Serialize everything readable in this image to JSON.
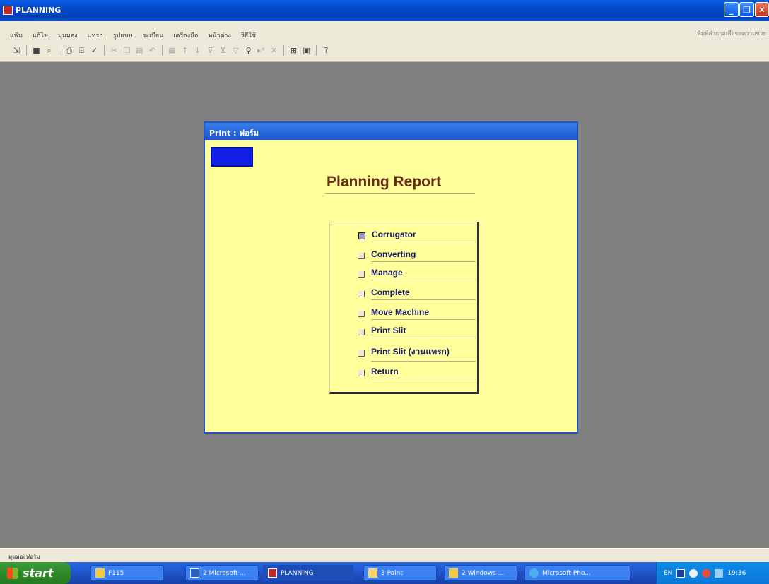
{
  "window": {
    "title": "PLANNING"
  },
  "menu": [
    "แฟ้ม",
    "แก้ไข",
    "มุมมอง",
    "แทรก",
    "รูปแบบ",
    "ระเบียน",
    "เครื่องมือ",
    "หน้าต่าง",
    "วิธีใช้"
  ],
  "help_placeholder": "พิมพ์คำถามเพื่อขอความช่วย",
  "form": {
    "title": "Print : ฟอร์ม",
    "heading": "Planning Report",
    "options": [
      {
        "label": "Corrugator",
        "selected": true
      },
      {
        "label": "Converting",
        "selected": false
      },
      {
        "label": "Manage",
        "selected": false
      },
      {
        "label": "Complete",
        "selected": false
      },
      {
        "label": "Move Machine",
        "selected": false
      },
      {
        "label": "Print Slit",
        "selected": false
      },
      {
        "label": "Print Slit (งานแทรก)",
        "selected": false
      },
      {
        "label": "Return",
        "selected": false
      }
    ]
  },
  "status_text": "มุมมองฟอร์ม",
  "taskbar": {
    "start_label": "start",
    "tasks": [
      "F115",
      "2 Microsoft ...",
      "PLANNING",
      "3 Paint",
      "2 Windows ...",
      "Microsoft Pho..."
    ],
    "tray_lang": "EN",
    "clock": "19:36"
  },
  "colors": {
    "form_bg": "#ffff9c",
    "workspace_bg": "#7f7f7f",
    "heading": "#6a2a10",
    "title_bar": "#0545c8"
  }
}
